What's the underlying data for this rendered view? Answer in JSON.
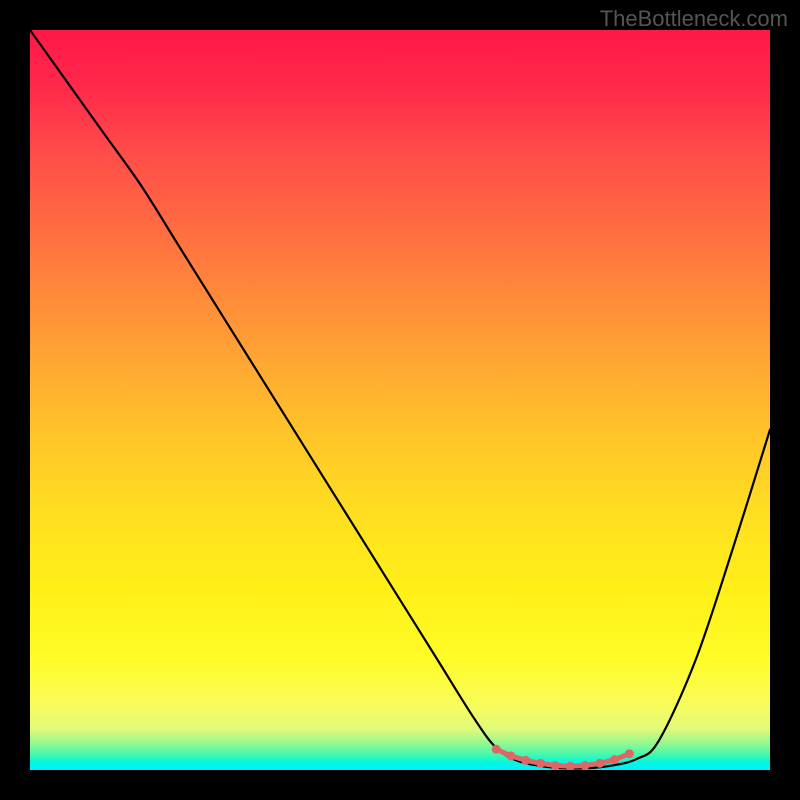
{
  "watermark": "TheBottleneck.com",
  "chart_data": {
    "type": "line",
    "title": "",
    "xlabel": "",
    "ylabel": "",
    "xlim": [
      0,
      100
    ],
    "ylim": [
      0,
      100
    ],
    "grid": false,
    "series": [
      {
        "name": "curve",
        "color": "#000000",
        "x": [
          0,
          5,
          10,
          15,
          20,
          25,
          30,
          35,
          40,
          45,
          50,
          55,
          60,
          63,
          66,
          70,
          74,
          78,
          82,
          85,
          90,
          95,
          100
        ],
        "y": [
          100,
          93,
          86,
          79,
          71,
          63,
          55,
          47,
          39,
          31,
          23,
          15,
          7,
          3,
          1.2,
          0.4,
          0.2,
          0.5,
          1.5,
          4,
          15,
          30,
          46
        ]
      }
    ],
    "highlight": {
      "name": "bottom-markers",
      "color": "#e06666",
      "x": [
        63,
        65,
        67,
        69,
        71,
        73,
        75,
        77,
        79,
        81
      ],
      "y": [
        2.8,
        1.9,
        1.3,
        0.9,
        0.6,
        0.5,
        0.6,
        0.9,
        1.4,
        2.2
      ]
    },
    "gradient_stops": [
      {
        "pos": 0,
        "color": "#ff1848"
      },
      {
        "pos": 0.08,
        "color": "#ff2a4a"
      },
      {
        "pos": 0.16,
        "color": "#ff4a4a"
      },
      {
        "pos": 0.26,
        "color": "#ff6a42"
      },
      {
        "pos": 0.36,
        "color": "#ff8a3a"
      },
      {
        "pos": 0.46,
        "color": "#ffaa32"
      },
      {
        "pos": 0.56,
        "color": "#ffc828"
      },
      {
        "pos": 0.66,
        "color": "#ffe020"
      },
      {
        "pos": 0.76,
        "color": "#fff018"
      },
      {
        "pos": 0.85,
        "color": "#fffc28"
      },
      {
        "pos": 0.91,
        "color": "#fafc5a"
      },
      {
        "pos": 0.945,
        "color": "#e0fa7a"
      },
      {
        "pos": 0.965,
        "color": "#90f890"
      },
      {
        "pos": 0.98,
        "color": "#40f8b0"
      },
      {
        "pos": 0.99,
        "color": "#00f8e0"
      },
      {
        "pos": 1.0,
        "color": "#00f0ff"
      }
    ]
  }
}
